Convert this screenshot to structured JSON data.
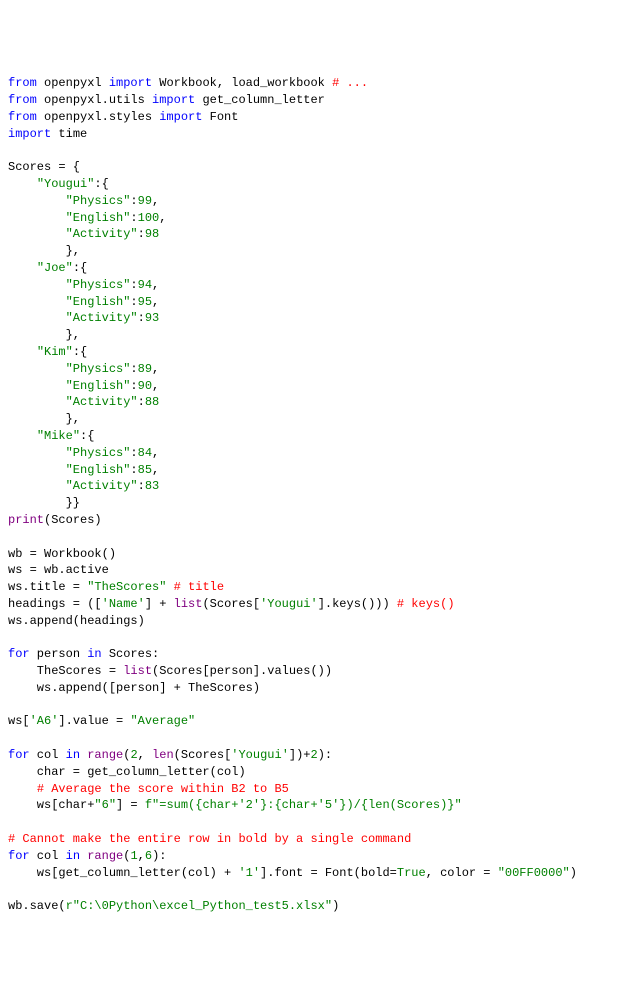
{
  "code": {
    "lines": [
      {
        "t": [
          {
            "c": "kw",
            "v": "from"
          },
          {
            "c": "id",
            "v": " openpyxl "
          },
          {
            "c": "kw",
            "v": "import"
          },
          {
            "c": "id",
            "v": " Workbook, load_workbook "
          },
          {
            "c": "cmt",
            "v": "# ..."
          }
        ]
      },
      {
        "t": [
          {
            "c": "kw",
            "v": "from"
          },
          {
            "c": "id",
            "v": " openpyxl.utils "
          },
          {
            "c": "kw",
            "v": "import"
          },
          {
            "c": "id",
            "v": " get_column_letter"
          }
        ]
      },
      {
        "t": [
          {
            "c": "kw",
            "v": "from"
          },
          {
            "c": "id",
            "v": " openpyxl.styles "
          },
          {
            "c": "kw",
            "v": "import"
          },
          {
            "c": "id",
            "v": " Font"
          }
        ]
      },
      {
        "t": [
          {
            "c": "kw",
            "v": "import"
          },
          {
            "c": "id",
            "v": " time"
          }
        ]
      },
      {
        "t": []
      },
      {
        "t": [
          {
            "c": "id",
            "v": "Scores = {"
          }
        ]
      },
      {
        "t": [
          {
            "c": "id",
            "v": "    "
          },
          {
            "c": "str",
            "v": "\"Yougui\""
          },
          {
            "c": "id",
            "v": ":{"
          }
        ]
      },
      {
        "t": [
          {
            "c": "id",
            "v": "        "
          },
          {
            "c": "str",
            "v": "\"Physics\""
          },
          {
            "c": "id",
            "v": ":"
          },
          {
            "c": "num",
            "v": "99"
          },
          {
            "c": "id",
            "v": ","
          }
        ]
      },
      {
        "t": [
          {
            "c": "id",
            "v": "        "
          },
          {
            "c": "str",
            "v": "\"English\""
          },
          {
            "c": "id",
            "v": ":"
          },
          {
            "c": "num",
            "v": "100"
          },
          {
            "c": "id",
            "v": ","
          }
        ]
      },
      {
        "t": [
          {
            "c": "id",
            "v": "        "
          },
          {
            "c": "str",
            "v": "\"Activity\""
          },
          {
            "c": "id",
            "v": ":"
          },
          {
            "c": "num",
            "v": "98"
          }
        ]
      },
      {
        "t": [
          {
            "c": "id",
            "v": "        },"
          }
        ]
      },
      {
        "t": [
          {
            "c": "id",
            "v": "    "
          },
          {
            "c": "str",
            "v": "\"Joe\""
          },
          {
            "c": "id",
            "v": ":{"
          }
        ]
      },
      {
        "t": [
          {
            "c": "id",
            "v": "        "
          },
          {
            "c": "str",
            "v": "\"Physics\""
          },
          {
            "c": "id",
            "v": ":"
          },
          {
            "c": "num",
            "v": "94"
          },
          {
            "c": "id",
            "v": ","
          }
        ]
      },
      {
        "t": [
          {
            "c": "id",
            "v": "        "
          },
          {
            "c": "str",
            "v": "\"English\""
          },
          {
            "c": "id",
            "v": ":"
          },
          {
            "c": "num",
            "v": "95"
          },
          {
            "c": "id",
            "v": ","
          }
        ]
      },
      {
        "t": [
          {
            "c": "id",
            "v": "        "
          },
          {
            "c": "str",
            "v": "\"Activity\""
          },
          {
            "c": "id",
            "v": ":"
          },
          {
            "c": "num",
            "v": "93"
          }
        ]
      },
      {
        "t": [
          {
            "c": "id",
            "v": "        },"
          }
        ]
      },
      {
        "t": [
          {
            "c": "id",
            "v": "    "
          },
          {
            "c": "str",
            "v": "\"Kim\""
          },
          {
            "c": "id",
            "v": ":{"
          }
        ]
      },
      {
        "t": [
          {
            "c": "id",
            "v": "        "
          },
          {
            "c": "str",
            "v": "\"Physics\""
          },
          {
            "c": "id",
            "v": ":"
          },
          {
            "c": "num",
            "v": "89"
          },
          {
            "c": "id",
            "v": ","
          }
        ]
      },
      {
        "t": [
          {
            "c": "id",
            "v": "        "
          },
          {
            "c": "str",
            "v": "\"English\""
          },
          {
            "c": "id",
            "v": ":"
          },
          {
            "c": "num",
            "v": "90"
          },
          {
            "c": "id",
            "v": ","
          }
        ]
      },
      {
        "t": [
          {
            "c": "id",
            "v": "        "
          },
          {
            "c": "str",
            "v": "\"Activity\""
          },
          {
            "c": "id",
            "v": ":"
          },
          {
            "c": "num",
            "v": "88"
          }
        ]
      },
      {
        "t": [
          {
            "c": "id",
            "v": "        },"
          }
        ]
      },
      {
        "t": [
          {
            "c": "id",
            "v": "    "
          },
          {
            "c": "str",
            "v": "\"Mike\""
          },
          {
            "c": "id",
            "v": ":{"
          }
        ]
      },
      {
        "t": [
          {
            "c": "id",
            "v": "        "
          },
          {
            "c": "str",
            "v": "\"Physics\""
          },
          {
            "c": "id",
            "v": ":"
          },
          {
            "c": "num",
            "v": "84"
          },
          {
            "c": "id",
            "v": ","
          }
        ]
      },
      {
        "t": [
          {
            "c": "id",
            "v": "        "
          },
          {
            "c": "str",
            "v": "\"English\""
          },
          {
            "c": "id",
            "v": ":"
          },
          {
            "c": "num",
            "v": "85"
          },
          {
            "c": "id",
            "v": ","
          }
        ]
      },
      {
        "t": [
          {
            "c": "id",
            "v": "        "
          },
          {
            "c": "str",
            "v": "\"Activity\""
          },
          {
            "c": "id",
            "v": ":"
          },
          {
            "c": "num",
            "v": "83"
          }
        ]
      },
      {
        "t": [
          {
            "c": "id",
            "v": "        }}"
          }
        ]
      },
      {
        "t": [
          {
            "c": "fn",
            "v": "print"
          },
          {
            "c": "id",
            "v": "(Scores)"
          }
        ]
      },
      {
        "t": []
      },
      {
        "t": [
          {
            "c": "id",
            "v": "wb = Workbook()"
          }
        ]
      },
      {
        "t": [
          {
            "c": "id",
            "v": "ws = wb.active"
          }
        ]
      },
      {
        "t": [
          {
            "c": "id",
            "v": "ws.title = "
          },
          {
            "c": "str",
            "v": "\"TheScores\""
          },
          {
            "c": "id",
            "v": " "
          },
          {
            "c": "cmt",
            "v": "# title"
          }
        ]
      },
      {
        "t": [
          {
            "c": "id",
            "v": "headings = (["
          },
          {
            "c": "str",
            "v": "'Name'"
          },
          {
            "c": "id",
            "v": "] + "
          },
          {
            "c": "fn",
            "v": "list"
          },
          {
            "c": "id",
            "v": "(Scores["
          },
          {
            "c": "str",
            "v": "'Yougui'"
          },
          {
            "c": "id",
            "v": "].keys())) "
          },
          {
            "c": "cmt",
            "v": "# keys()"
          }
        ]
      },
      {
        "t": [
          {
            "c": "id",
            "v": "ws.append(headings)"
          }
        ]
      },
      {
        "t": []
      },
      {
        "t": [
          {
            "c": "kw",
            "v": "for"
          },
          {
            "c": "id",
            "v": " person "
          },
          {
            "c": "kw",
            "v": "in"
          },
          {
            "c": "id",
            "v": " Scores:"
          }
        ]
      },
      {
        "t": [
          {
            "c": "id",
            "v": "    TheScores = "
          },
          {
            "c": "fn",
            "v": "list"
          },
          {
            "c": "id",
            "v": "(Scores[person].values())"
          }
        ]
      },
      {
        "t": [
          {
            "c": "id",
            "v": "    ws.append([person] + TheScores)"
          }
        ]
      },
      {
        "t": []
      },
      {
        "t": [
          {
            "c": "id",
            "v": "ws["
          },
          {
            "c": "str",
            "v": "'A6'"
          },
          {
            "c": "id",
            "v": "].value = "
          },
          {
            "c": "str",
            "v": "\"Average\""
          }
        ]
      },
      {
        "t": []
      },
      {
        "t": [
          {
            "c": "kw",
            "v": "for"
          },
          {
            "c": "id",
            "v": " col "
          },
          {
            "c": "kw",
            "v": "in"
          },
          {
            "c": "id",
            "v": " "
          },
          {
            "c": "fn",
            "v": "range"
          },
          {
            "c": "id",
            "v": "("
          },
          {
            "c": "num",
            "v": "2"
          },
          {
            "c": "id",
            "v": ", "
          },
          {
            "c": "fn",
            "v": "len"
          },
          {
            "c": "id",
            "v": "(Scores["
          },
          {
            "c": "str",
            "v": "'Yougui'"
          },
          {
            "c": "id",
            "v": "])+"
          },
          {
            "c": "num",
            "v": "2"
          },
          {
            "c": "id",
            "v": "):"
          }
        ]
      },
      {
        "t": [
          {
            "c": "id",
            "v": "    char = get_column_letter(col)"
          }
        ]
      },
      {
        "t": [
          {
            "c": "id",
            "v": "    "
          },
          {
            "c": "cmt",
            "v": "# Average the score within B2 to B5"
          }
        ]
      },
      {
        "t": [
          {
            "c": "id",
            "v": "    ws[char+"
          },
          {
            "c": "str",
            "v": "\"6\""
          },
          {
            "c": "id",
            "v": "] = "
          },
          {
            "c": "str",
            "v": "f\"=sum({char+'2'}:{char+'5'})/{len(Scores)}\""
          }
        ]
      },
      {
        "t": []
      },
      {
        "t": [
          {
            "c": "cmt",
            "v": "# Cannot make the entire row in bold by a single command"
          }
        ]
      },
      {
        "t": [
          {
            "c": "kw",
            "v": "for"
          },
          {
            "c": "id",
            "v": " col "
          },
          {
            "c": "kw",
            "v": "in"
          },
          {
            "c": "id",
            "v": " "
          },
          {
            "c": "fn",
            "v": "range"
          },
          {
            "c": "id",
            "v": "("
          },
          {
            "c": "num",
            "v": "1"
          },
          {
            "c": "id",
            "v": ","
          },
          {
            "c": "num",
            "v": "6"
          },
          {
            "c": "id",
            "v": "):"
          }
        ]
      },
      {
        "t": [
          {
            "c": "id",
            "v": "    ws[get_column_letter(col) + "
          },
          {
            "c": "str",
            "v": "'1'"
          },
          {
            "c": "id",
            "v": "].font = Font(bold="
          },
          {
            "c": "bool",
            "v": "True"
          },
          {
            "c": "id",
            "v": ", color = "
          },
          {
            "c": "str",
            "v": "\"00FF0000\""
          },
          {
            "c": "id",
            "v": ")"
          }
        ]
      },
      {
        "t": []
      },
      {
        "t": [
          {
            "c": "id",
            "v": "wb.save("
          },
          {
            "c": "str",
            "v": "r\"C:\\0Python\\excel_Python_test5.xlsx\""
          },
          {
            "c": "id",
            "v": ")"
          }
        ]
      }
    ]
  }
}
